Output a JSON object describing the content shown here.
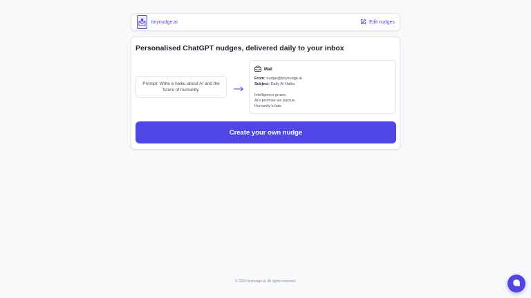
{
  "header": {
    "brand": "tinynudge.ai",
    "edit_label": "Edit nudges",
    "brand_icon": "envelope-logo-icon",
    "edit_icon": "pencil-square-icon"
  },
  "main": {
    "title": "Personalised ChatGPT nudges, delivered daily to your inbox",
    "prompt_text": "Prompt: Write a haiku about AI and the future of humanity.",
    "mail": {
      "app_label": "Mail",
      "from_label": "From:",
      "from_value": "nudge@tinynudge.ai",
      "subject_label": "Subject:",
      "subject_value": "Daily AI Haiku",
      "body_lines": [
        "Intelligence grows,",
        "AI's promise we pursue,",
        "Humanity's fate."
      ]
    },
    "cta_label": "Create your own nudge"
  },
  "footer": {
    "text": "© 2023 tinynudge.ai. All rights reserved."
  },
  "colors": {
    "accent": "#4f46e5",
    "background": "#f8f9fb",
    "card": "#ffffff",
    "border": "#e2e5ec"
  }
}
